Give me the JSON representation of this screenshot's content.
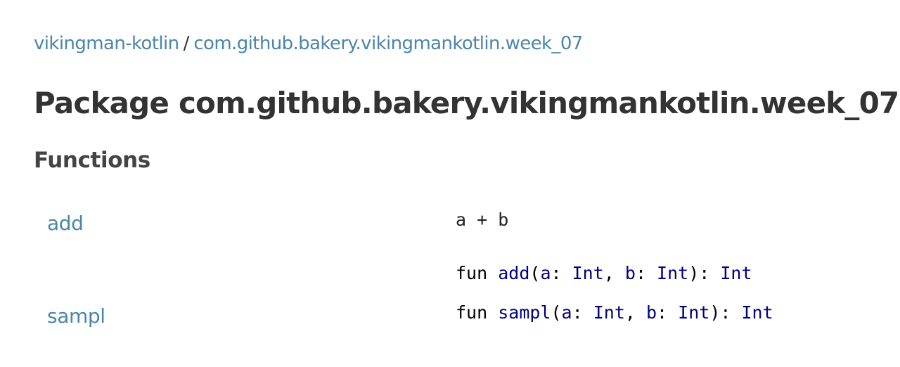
{
  "breadcrumb": {
    "module": "vikingman-kotlin",
    "separator": "/",
    "package": "com.github.bakery.vikingmankotlin.week_07"
  },
  "page": {
    "title": "Package com.github.bakery.vikingmankotlin.week_07"
  },
  "functions_section": {
    "title": "Functions",
    "items": [
      {
        "name": "add",
        "description": "a + b",
        "signature": {
          "keyword": "fun",
          "name": "add",
          "params": [
            {
              "name": "a",
              "type": "Int"
            },
            {
              "name": "b",
              "type": "Int"
            }
          ],
          "return_type": "Int"
        }
      },
      {
        "name": "sampl",
        "description": "",
        "signature": {
          "keyword": "fun",
          "name": "sampl",
          "params": [
            {
              "name": "a",
              "type": "Int"
            },
            {
              "name": "b",
              "type": "Int"
            }
          ],
          "return_type": "Int"
        }
      }
    ]
  },
  "colors": {
    "link": "#4a86a8",
    "heading": "#333333",
    "code_identifier": "#000080",
    "code_keyword": "#000000"
  }
}
